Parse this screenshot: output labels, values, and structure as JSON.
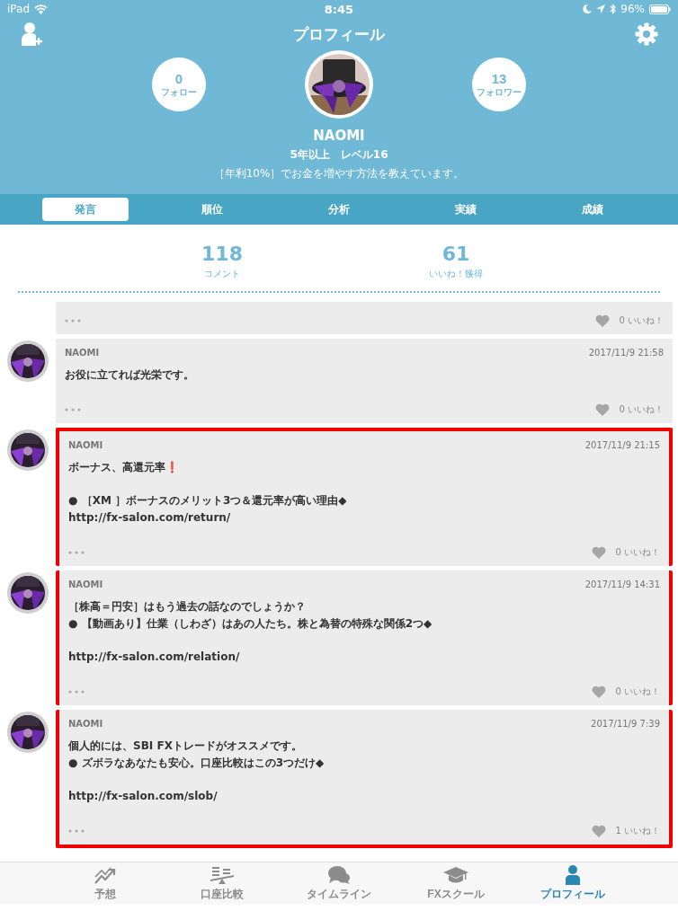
{
  "status_bar": {
    "device": "iPad",
    "time": "8:45",
    "battery": "96%"
  },
  "header": {
    "title": "プロフィール",
    "follow": {
      "count": "0",
      "label": "フォロー"
    },
    "followers": {
      "count": "13",
      "label": "フォロワー"
    },
    "name": "NAOMI",
    "meta": "5年以上　レベル16",
    "bio": "［年利10%］でお金を増やす方法を教えています。"
  },
  "tabs": [
    {
      "label": "発言",
      "selected": true
    },
    {
      "label": "順位",
      "selected": false
    },
    {
      "label": "分析",
      "selected": false
    },
    {
      "label": "実績",
      "selected": false
    },
    {
      "label": "成績",
      "selected": false
    }
  ],
  "stats": [
    {
      "value": "118",
      "label": "コメント"
    },
    {
      "value": "61",
      "label": "いいね！獲得"
    }
  ],
  "posts": [
    {
      "likes": "0 いいね！",
      "highlighted": false
    },
    {
      "author": "NAOMI",
      "date": "2017/11/9 21:58",
      "paragraphs": [
        [
          "お役に立てれば光栄です。"
        ]
      ],
      "likes": "0 いいね！",
      "highlighted": false
    },
    {
      "author": "NAOMI",
      "date": "2017/11/9 21:15",
      "paragraphs": [
        [
          "ボーナス、高還元率❗"
        ],
        [
          "● ［XM ］ボーナスのメリット3つ＆還元率が高い理由◆",
          "http://fx-salon.com/return/"
        ]
      ],
      "likes": "0 いいね！",
      "highlighted": true
    },
    {
      "author": "NAOMI",
      "date": "2017/11/9 14:31",
      "paragraphs": [
        [
          "［株高＝円安］はもう過去の話なのでしょうか？",
          "● 【動画あり】仕業（しわざ）はあの人たち。株と為替の特殊な関係2つ◆"
        ],
        [
          "http://fx-salon.com/relation/"
        ]
      ],
      "likes": "0 いいね！",
      "highlighted": true
    },
    {
      "author": "NAOMI",
      "date": "2017/11/9 7:39",
      "paragraphs": [
        [
          "個人的には、SBI FXトレードがオススメです。",
          "● ズボラなあなたも安心。口座比較はこの3つだけ◆"
        ],
        [
          "http://fx-salon.com/slob/"
        ]
      ],
      "likes": "1 いいね！",
      "highlighted": true
    }
  ],
  "nav": [
    {
      "label": "予想",
      "kind": "chart",
      "selected": false
    },
    {
      "label": "口座比較",
      "kind": "scale",
      "selected": false
    },
    {
      "label": "タイムライン",
      "kind": "chat",
      "selected": false
    },
    {
      "label": "FXスクール",
      "kind": "cap",
      "selected": false
    },
    {
      "label": "プロフィール",
      "kind": "person",
      "selected": true
    }
  ]
}
